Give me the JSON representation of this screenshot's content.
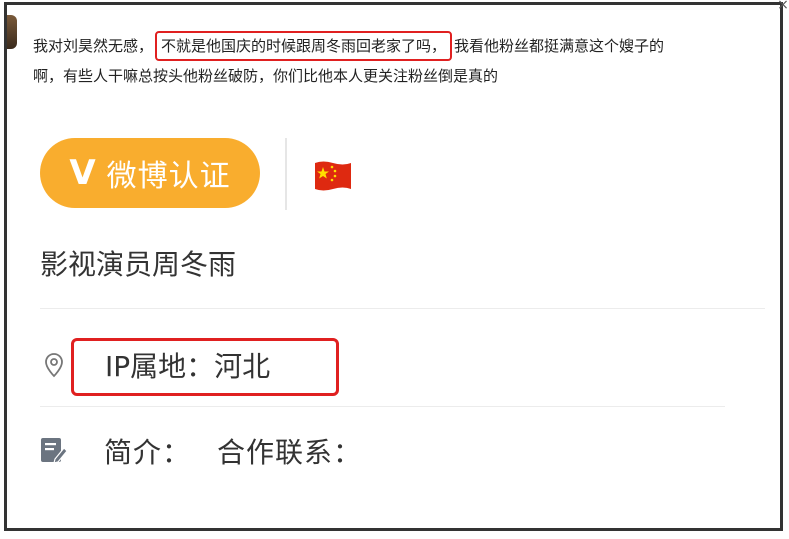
{
  "comment": {
    "before": "我对刘昊然无感，",
    "highlighted": "不就是他国庆的时候跟周冬雨回老家了吗，",
    "after": "我看他粉丝都挺满意这个嫂子的",
    "line2": "啊，有些人干嘛总按头他粉丝破防，你们比他本人更关注粉丝倒是真的"
  },
  "verify": {
    "mark": "V",
    "label": "微博认证"
  },
  "flag_icon": "china-flag-icon",
  "profile": {
    "title": "影视演员周冬雨",
    "ip_label": "IP属地：河北",
    "bio_label": "简介：",
    "bio_value": "合作联系："
  },
  "colors": {
    "highlight_border": "#e02020",
    "badge_bg": "#f9ad2e",
    "frame_border": "#333333"
  }
}
